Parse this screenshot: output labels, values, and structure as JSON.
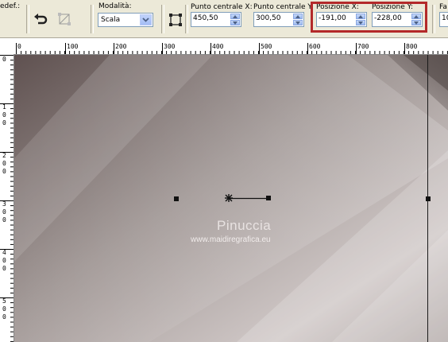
{
  "toolbar": {
    "preset_partial": "edef.:",
    "mode_label": "Modalità:",
    "mode_value": "Scala",
    "center_x_label": "Punto centrale X:",
    "center_x_value": "450,50",
    "center_y_label": "Punto centrale Y:",
    "center_y_value": "300,50",
    "pos_x_label": "Posizione X:",
    "pos_x_value": "-191,00",
    "pos_y_label": "Posizione Y:",
    "pos_y_value": "-228,00",
    "cut_label": "Fa",
    "cut_value": "10"
  },
  "rulers": {
    "top": [
      "0",
      "100",
      "200",
      "300",
      "400",
      "500",
      "600",
      "700",
      "800"
    ],
    "left": [
      "0",
      "100",
      "200",
      "300",
      "400",
      "500"
    ]
  },
  "canvas": {
    "watermark_title": "Pinuccia",
    "watermark_url": "www.maidiregrafica.eu"
  },
  "colors": {
    "highlight_border": "#b3292a",
    "toolbar_bg": "#ece9d8"
  }
}
